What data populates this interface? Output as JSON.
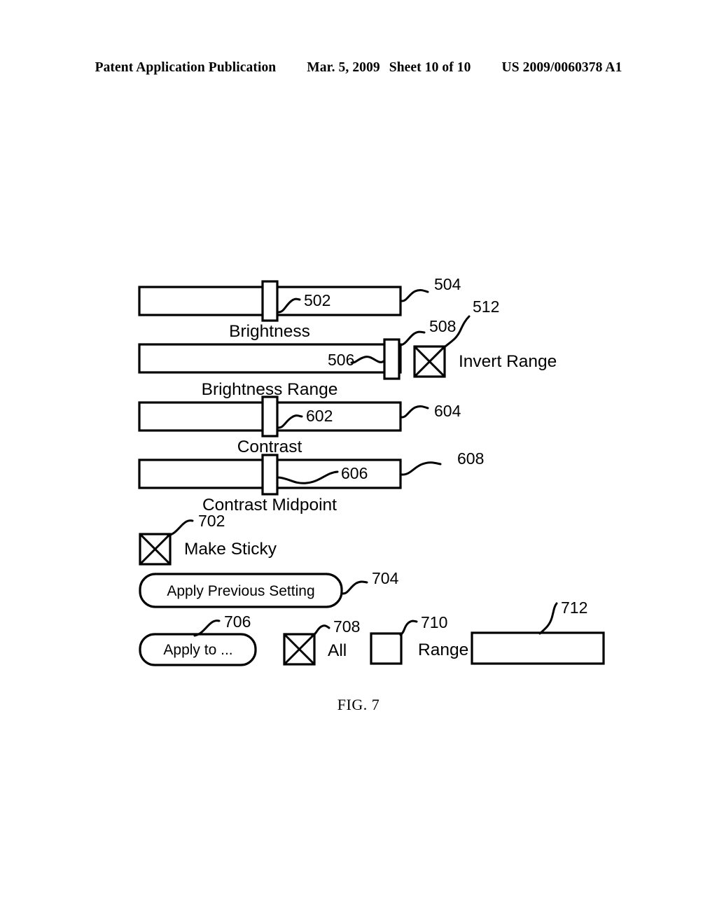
{
  "header": {
    "publication": "Patent Application Publication",
    "date": "Mar. 5, 2009",
    "sheet": "Sheet 10 of 10",
    "number": "US 2009/0060378 A1"
  },
  "figure": {
    "caption": "FIG. 7",
    "sliders": [
      {
        "label": "Brightness",
        "thumb_ref": "502",
        "track_ref": "504"
      },
      {
        "label": "Brightness Range",
        "thumb_ref": "506",
        "track_ref": "508"
      },
      {
        "label": "Contrast",
        "thumb_ref": "602",
        "track_ref": "604"
      },
      {
        "label": "Contrast Midpoint",
        "thumb_ref": "606",
        "track_ref": "608"
      }
    ],
    "checkboxes": [
      {
        "label": "Invert Range",
        "ref": "512",
        "checked": "true"
      },
      {
        "label": "Make Sticky",
        "ref": "702",
        "checked": "true"
      },
      {
        "label": "All",
        "ref": "708",
        "checked": "true"
      },
      {
        "label": "Range",
        "ref": "710",
        "checked": "false"
      }
    ],
    "buttons": [
      {
        "label": "Apply Previous Setting",
        "ref": "704"
      },
      {
        "label": "Apply to ...",
        "ref": "706"
      }
    ],
    "fields": [
      {
        "label": "",
        "ref": "712"
      }
    ]
  },
  "colors": {
    "ink": "#000000",
    "paper": "#ffffff"
  }
}
